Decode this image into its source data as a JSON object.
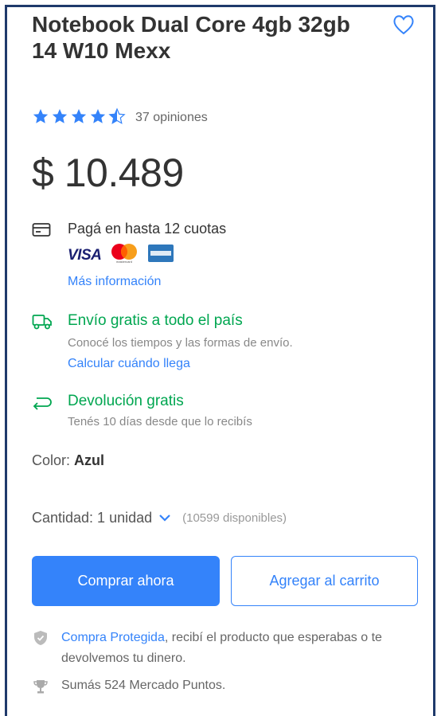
{
  "product": {
    "title": "Notebook Dual Core 4gb 32gb 14 W10 Mexx",
    "rating_value": 4.5,
    "reviews": "37 opiniones",
    "price": "$ 10.489"
  },
  "payment": {
    "installments": "Pagá en hasta 12 cuotas",
    "cards": [
      "VISA",
      "mastercard",
      "amex"
    ],
    "more_info": "Más información"
  },
  "shipping": {
    "title": "Envío gratis a todo el país",
    "subtitle": "Conocé los tiempos y las formas de envío.",
    "link": "Calcular cuándo llega"
  },
  "returns": {
    "title": "Devolución gratis",
    "subtitle": "Tenés 10 días desde que lo recibís"
  },
  "color": {
    "label": "Color:",
    "value": "Azul"
  },
  "quantity": {
    "label": "Cantidad: 1 unidad",
    "available": "(10599 disponibles)"
  },
  "actions": {
    "buy_now": "Comprar ahora",
    "add_to_cart": "Agregar al carrito"
  },
  "protection": {
    "link": "Compra Protegida",
    "text": ", recibí el producto que esperabas o te devolvemos tu dinero."
  },
  "points": {
    "text": "Sumás 524 Mercado Puntos."
  },
  "colors": {
    "accent": "#3483fa",
    "green": "#00a650",
    "frame": "#1f3a6b"
  },
  "icons": [
    "heart-icon",
    "star-icon",
    "card-icon",
    "truck-icon",
    "return-arrow-icon",
    "chevron-down-icon",
    "shield-icon",
    "trophy-icon"
  ]
}
